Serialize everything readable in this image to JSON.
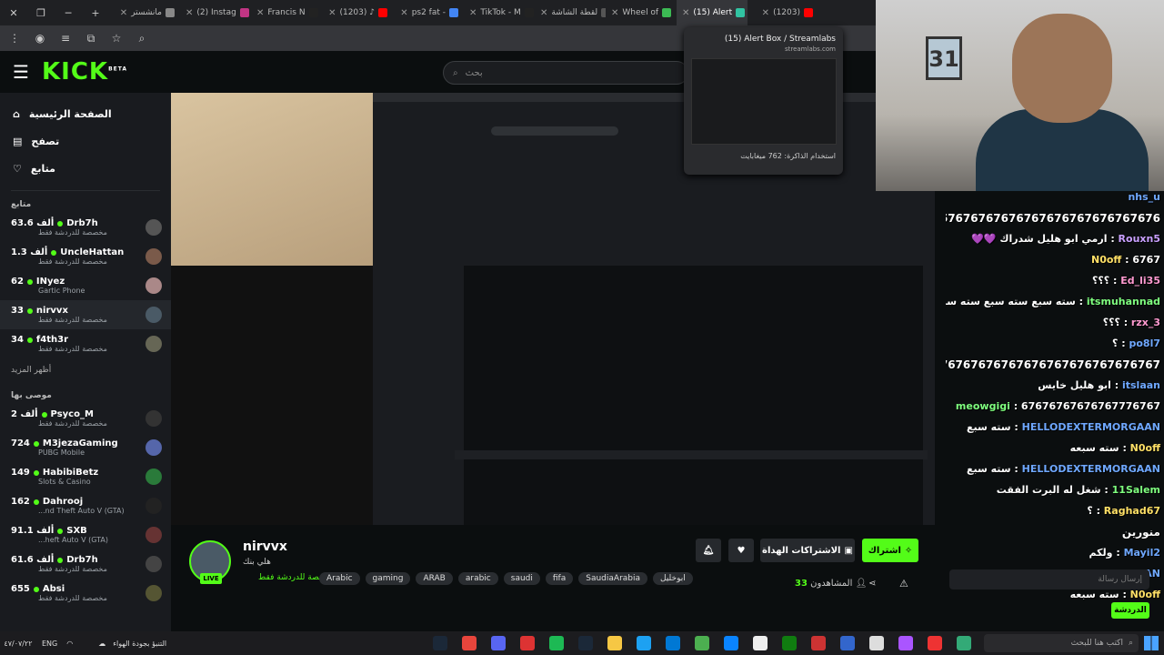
{
  "browser": {
    "tabs": [
      {
        "title": "مانشستر",
        "color": "#888"
      },
      {
        "title": "(2) Instag",
        "color": "#c13584"
      },
      {
        "title": "Francis N",
        "color": "#222"
      },
      {
        "title": "(1203) ♪",
        "color": "#ff0000"
      },
      {
        "title": "ps2 fat -",
        "color": "#4285f4"
      },
      {
        "title": "TikTok - M",
        "color": "#222"
      },
      {
        "title": "لقطة الشاشة",
        "color": "#555"
      },
      {
        "title": "Wheel of",
        "color": "#3cba54"
      },
      {
        "title": "(15) Alert",
        "color": "#31c3a2"
      },
      {
        "title": "(1203)",
        "color": "#ff0000"
      }
    ],
    "tooltip": {
      "title": "(15) Alert Box / Streamlabs",
      "domain": "streamlabs.com",
      "memory": "استخدام الذاكرة: 762 ميغابايت"
    }
  },
  "kick": {
    "logo": "KICK",
    "logo_beta": "BETA",
    "search_placeholder": "بحث",
    "nav": [
      {
        "label": "الصفحة الرئيسية",
        "icon": "home-icon"
      },
      {
        "label": "تصفح",
        "icon": "browse-icon"
      },
      {
        "label": "متابع",
        "icon": "heart-icon"
      }
    ],
    "followed_title": "متابع",
    "followed": [
      {
        "name": "Drb7h",
        "viewers": "63.6 ألف",
        "category": "مخصصة للدردشة فقط"
      },
      {
        "name": "UncleHattan",
        "viewers": "1.3 ألف",
        "category": "مخصصة للدردشة فقط"
      },
      {
        "name": "INyez",
        "viewers": "62",
        "category": "Gartic Phone"
      },
      {
        "name": "nirvvx",
        "viewers": "33",
        "category": "مخصصة للدردشة فقط"
      },
      {
        "name": "f4th3r",
        "viewers": "34",
        "category": "مخصصة للدردشة فقط"
      }
    ],
    "show_more": "أظهر المزيد",
    "recommended_title": "موصى بها",
    "recommended": [
      {
        "name": "Psyco_M",
        "viewers": "2 ألف",
        "category": "مخصصة للدردشة فقط"
      },
      {
        "name": "M3jezaGaming",
        "viewers": "724",
        "category": "PUBG Mobile"
      },
      {
        "name": "HabibiBetz",
        "viewers": "149",
        "category": "Slots & Casino"
      },
      {
        "name": "Dahrooj",
        "viewers": "162",
        "category": "...nd Theft Auto V (GTA)"
      },
      {
        "name": "SXB",
        "viewers": "91.1 ألف",
        "category": "...heft Auto V (GTA)"
      },
      {
        "name": "Drb7h",
        "viewers": "61.6 ألف",
        "category": "مخصصة للدردشة فقط"
      },
      {
        "name": "Absi",
        "viewers": "655",
        "category": "مخصصة للدردشة فقط"
      }
    ]
  },
  "stream": {
    "name": "nirvvx",
    "title": "هلي بنك",
    "category": "مخصصة للدردشة فقط",
    "live_label": "LIVE",
    "tags": [
      "Arabic",
      "gaming",
      "ARAB",
      "arabic",
      "saudi",
      "fifa",
      "SaudiaArabia",
      "ابوخليل"
    ],
    "subscribe_label": "اشتراك",
    "gift_label": "الاشتراكات الهداة",
    "viewers_label": "المشاهدون",
    "viewers_count": "33"
  },
  "chat": {
    "messages": [
      {
        "user": "nhs_u",
        "text": "",
        "color": "blue"
      },
      {
        "user": "",
        "text": "67676767676767676767676767676767676767676767676767676",
        "color": ""
      },
      {
        "user": "Rouxn5",
        "text": "ارمي ابو هليل شدراك 💜💜",
        "color": "purple"
      },
      {
        "user": "N0off",
        "text": "6767",
        "color": "yellow"
      },
      {
        "user": "Ed_li35",
        "text": "؟؟؟",
        "color": "pink"
      },
      {
        "user": "itsmuhannad",
        "text": "سته سبع سته سبع سته سبع",
        "color": "green"
      },
      {
        "user": "rzx_3",
        "text": "؟؟؟",
        "color": "pink"
      },
      {
        "user": "po8l7",
        "text": "؟",
        "color": "blue"
      },
      {
        "user": "",
        "text": "67676767676767676767676767676767676767",
        "color": ""
      },
      {
        "user": "itslaan",
        "text": "ابو هليل خايس",
        "color": "blue"
      },
      {
        "user": "meowgigi",
        "text": "67676767676767776767",
        "color": "green"
      },
      {
        "user": "HELLODEXTERMORGAAN",
        "text": "سته سبع",
        "color": "blue"
      },
      {
        "user": "N0off",
        "text": "سته سبعه",
        "color": "yellow"
      },
      {
        "user": "HELLODEXTERMORGAAN",
        "text": "سته سبع",
        "color": "blue"
      },
      {
        "user": "11Salem",
        "text": "شغل له البرت الفقت",
        "color": "green"
      },
      {
        "user": "Raghad67",
        "text": "؟",
        "color": "yellow"
      },
      {
        "user": "",
        "text": "منورين",
        "color": ""
      },
      {
        "user": "Mayil2",
        "text": "ولكم",
        "color": "blue"
      },
      {
        "user": "HELLODEXTERMORGAAN",
        "text": "سته سبع",
        "color": "blue"
      },
      {
        "user": "N0off",
        "text": "سته سبعه",
        "color": "yellow"
      }
    ],
    "input_placeholder": "إرسال رسالة",
    "send_label": "الدردشة"
  },
  "taskbar": {
    "time": "",
    "date": "٤٧/٠٧/٢٢",
    "lang": "ENG",
    "weather": "التنبؤ بجودة الهواء",
    "search_placeholder": "اكتب هنا للبحث"
  },
  "colors": {
    "kick_green": "#53fc18",
    "background": "#0b0e0f",
    "sidebar": "#191b1f"
  }
}
